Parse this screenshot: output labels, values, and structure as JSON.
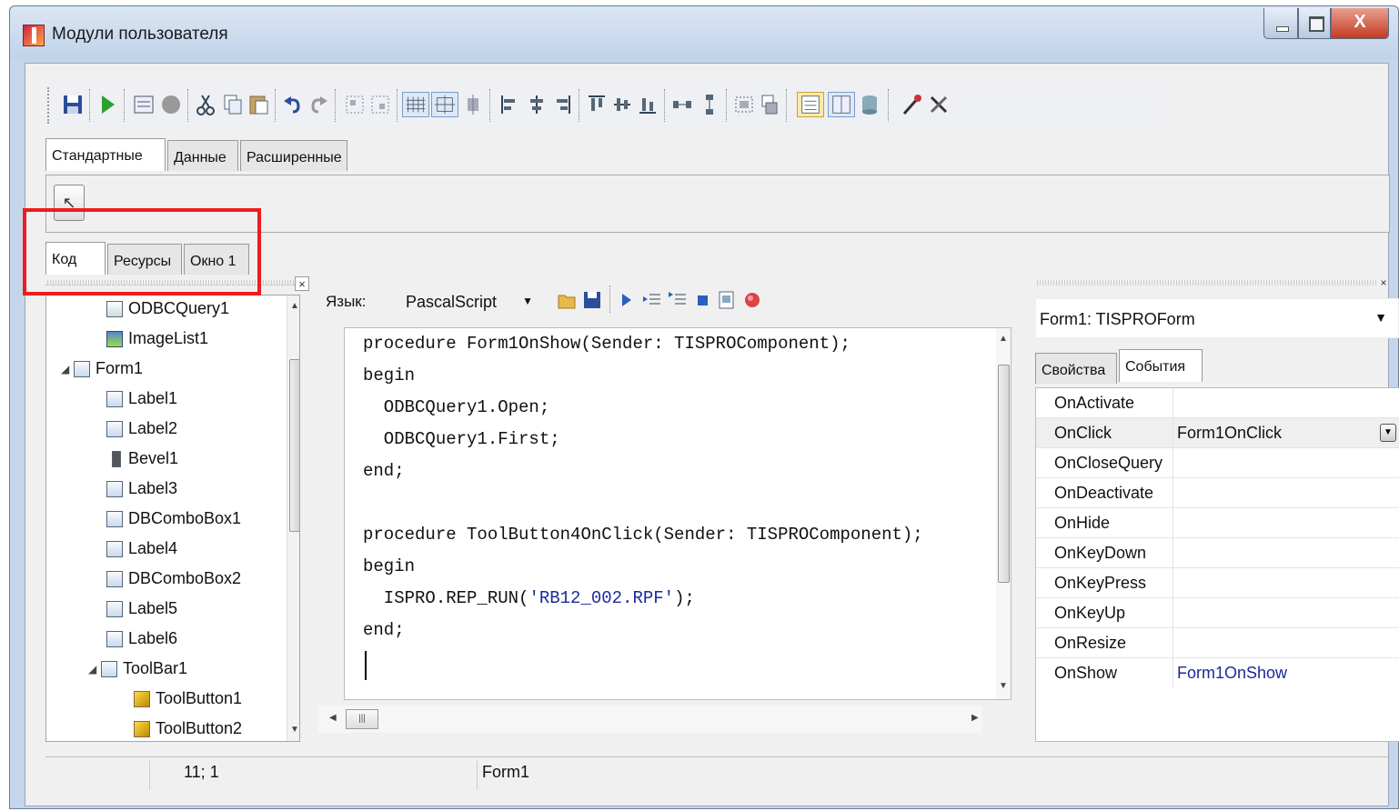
{
  "window": {
    "title": "Модули пользователя",
    "close_glyph": "X"
  },
  "toolbar": {
    "icons": [
      "save-icon",
      "run-icon",
      "form-icon",
      "stop-icon",
      "cut-icon",
      "copy-icon",
      "paste-icon",
      "undo-icon",
      "redo-icon",
      "group-icon",
      "ungroup-icon",
      "grid-icon",
      "align-grid-icon",
      "snap-icon",
      "align-left-icon",
      "align-center-icon",
      "align-right-icon",
      "align-top-icon",
      "align-middle-icon",
      "align-bottom-icon",
      "space-horizontal-icon",
      "space-vertical-icon",
      "size-icon",
      "order-icon",
      "inspector-icon",
      "tree-icon",
      "database-icon",
      "tools-icon",
      "settings-icon"
    ]
  },
  "palette_tabs": [
    "Стандартные",
    "Данные",
    "Расширенные"
  ],
  "palette": {
    "pointer_glyph": "↖"
  },
  "view_tabs": [
    "Код",
    "Ресурсы",
    "Окно 1"
  ],
  "tree": {
    "items": [
      {
        "label": "ODBCQuery1",
        "icon": "sql-icon"
      },
      {
        "label": "ImageList1",
        "icon": "imagelist-icon"
      },
      {
        "label": "Form1",
        "icon": "form-icon"
      },
      {
        "label": "Label1",
        "icon": "label-icon"
      },
      {
        "label": "Label2",
        "icon": "label-icon"
      },
      {
        "label": "Bevel1",
        "icon": "bevel-icon"
      },
      {
        "label": "Label3",
        "icon": "label-icon"
      },
      {
        "label": "DBComboBox1",
        "icon": "combobox-icon"
      },
      {
        "label": "Label4",
        "icon": "label-icon"
      },
      {
        "label": "DBComboBox2",
        "icon": "combobox-icon"
      },
      {
        "label": "Label5",
        "icon": "label-icon"
      },
      {
        "label": "Label6",
        "icon": "label-icon"
      },
      {
        "label": "ToolBar1",
        "icon": "toolbar-icon"
      },
      {
        "label": "ToolButton1",
        "icon": "toolbutton-icon"
      },
      {
        "label": "ToolButton2",
        "icon": "toolbutton-icon"
      }
    ]
  },
  "editor": {
    "language_label": "Язык:",
    "language_value": "PascalScript",
    "code_lines": [
      "procedure Form1OnShow(Sender: TISPROComponent);",
      "begin",
      "  ODBCQuery1.Open;",
      "  ODBCQuery1.First;",
      "end;",
      "",
      "procedure ToolButton4OnClick(Sender: TISPROComponent);",
      "begin",
      "  ISPRO.REP_RUN(",
      "end;"
    ],
    "string_literal": "'RB12_002.RPF'",
    "after_string": ");"
  },
  "inspector": {
    "component": "Form1: TISPROForm",
    "tabs": [
      "Свойства",
      "События"
    ],
    "events": [
      {
        "name": "OnActivate",
        "value": ""
      },
      {
        "name": "OnClick",
        "value": "Form1OnClick"
      },
      {
        "name": "OnCloseQuery",
        "value": ""
      },
      {
        "name": "OnDeactivate",
        "value": ""
      },
      {
        "name": "OnHide",
        "value": ""
      },
      {
        "name": "OnKeyDown",
        "value": ""
      },
      {
        "name": "OnKeyPress",
        "value": ""
      },
      {
        "name": "OnKeyUp",
        "value": ""
      },
      {
        "name": "OnResize",
        "value": ""
      },
      {
        "name": "OnShow",
        "value": "Form1OnShow"
      }
    ]
  },
  "status": {
    "position": "11; 1",
    "object": "Form1"
  }
}
